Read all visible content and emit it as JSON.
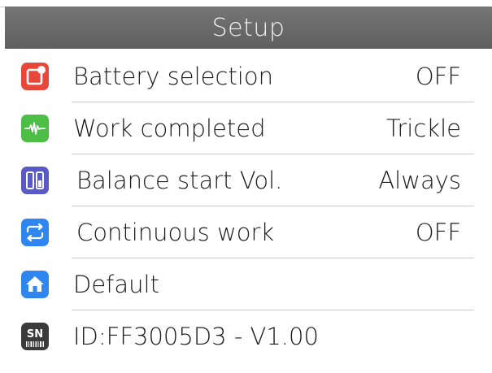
{
  "header": {
    "title": "Setup"
  },
  "menu": {
    "items": [
      {
        "label": "Battery selection",
        "value": "OFF",
        "icon": "battery-select-icon",
        "color": "#e8483a"
      },
      {
        "label": "Work completed",
        "value": "Trickle",
        "icon": "pulse-icon",
        "color": "#4cbd45"
      },
      {
        "label": "Balance start Vol.",
        "value": "Always",
        "icon": "battery-cells-icon",
        "color": "#5a59c8"
      },
      {
        "label": "Continuous work",
        "value": "OFF",
        "icon": "repeat-icon",
        "color": "#2f86f0"
      },
      {
        "label": "Default",
        "value": "",
        "icon": "home-icon",
        "color": "#2f86f0"
      },
      {
        "label": "ID:FF3005D3 - V1.00",
        "value": "",
        "icon": "sn-icon",
        "icon_text": "SN",
        "color": "#3a3a3a"
      }
    ]
  }
}
